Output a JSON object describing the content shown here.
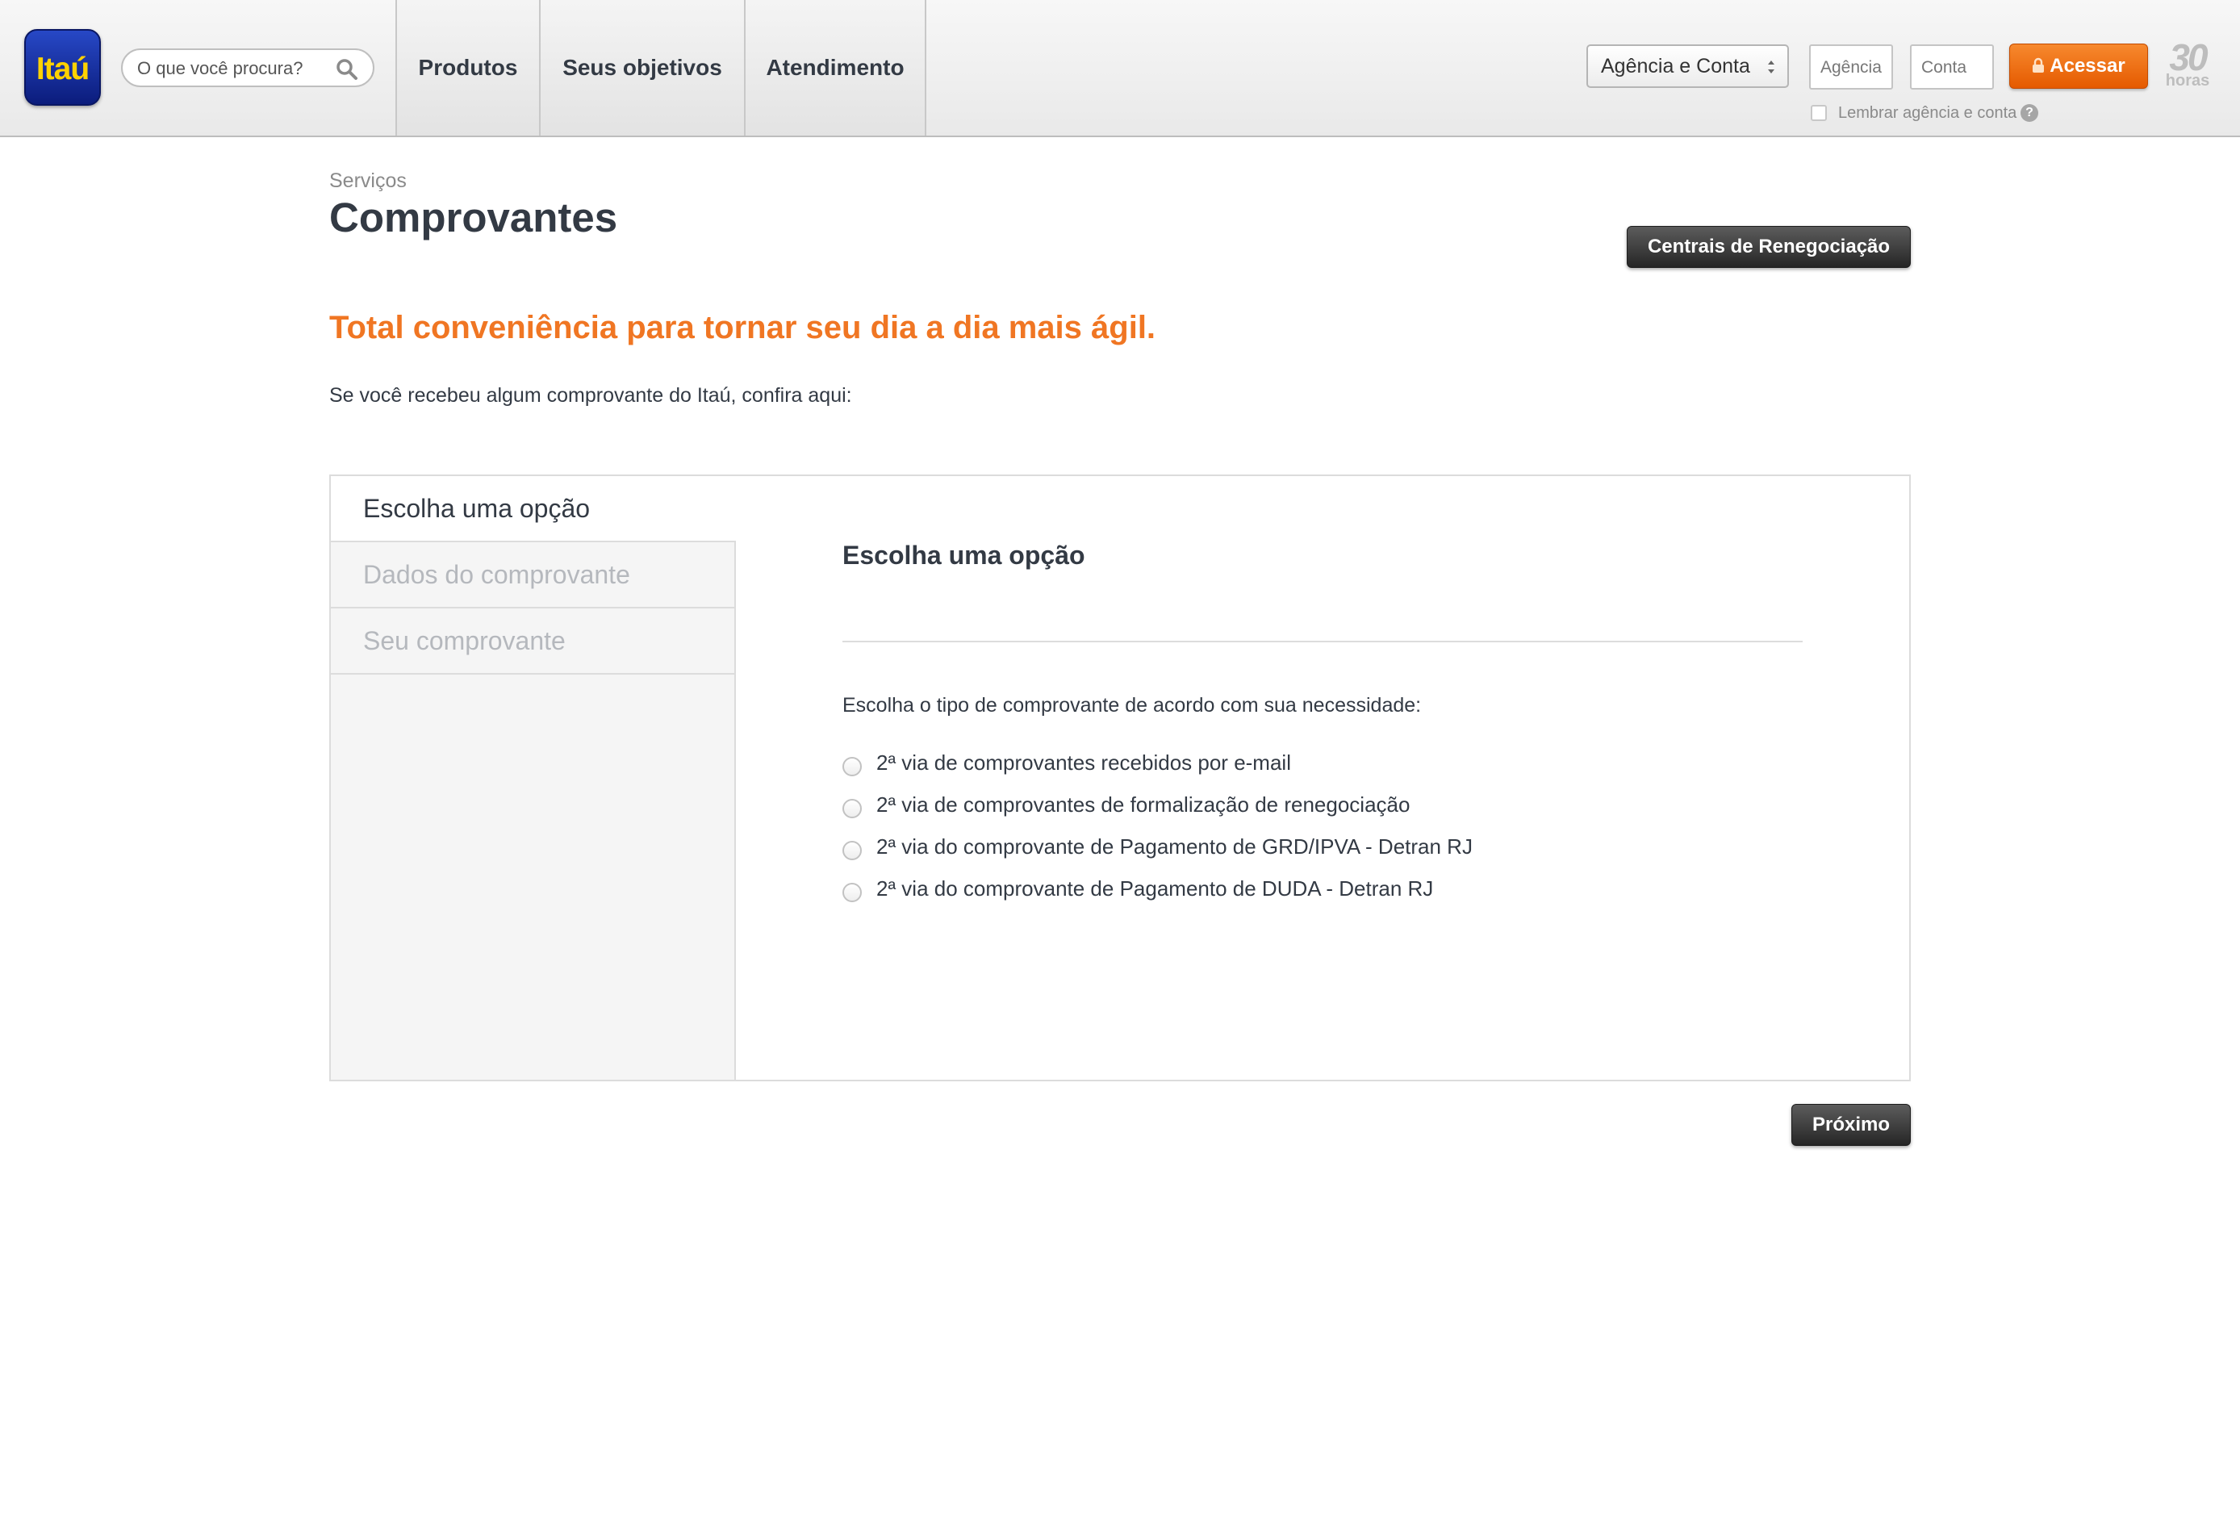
{
  "header": {
    "logo_text": "Itaú",
    "search": {
      "placeholder": "O que você procura?"
    },
    "nav": [
      "Produtos",
      "Seus objetivos",
      "Atendimento"
    ],
    "login": {
      "type_select": "Agência e Conta",
      "agencia_placeholder": "Agência",
      "conta_placeholder": "Conta",
      "acessar_label": "Acessar",
      "remember_label": "Lembrar agência e conta",
      "help_glyph": "?"
    },
    "badge_30": {
      "number": "30",
      "text": "horas"
    }
  },
  "page": {
    "breadcrumb": "Serviços",
    "title": "Comprovantes",
    "renegociacao_button": "Centrais de Renegociação",
    "headline": "Total conveniência para tornar seu dia a dia mais ágil.",
    "intro": "Se você recebeu algum comprovante do Itaú, confira aqui:"
  },
  "wizard": {
    "steps": [
      "Escolha uma opção",
      "Dados do comprovante",
      "Seu comprovante"
    ],
    "active_step": 0,
    "content_title": "Escolha uma opção",
    "question": "Escolha o tipo de comprovante de acordo com sua necessidade:",
    "options": [
      "2ª via de comprovantes recebidos por e-mail",
      "2ª via de comprovantes de formalização de renegociação",
      "2ª via do comprovante de Pagamento de GRD/IPVA - Detran RJ",
      "2ª via do comprovante de Pagamento de DUDA - Detran RJ"
    ],
    "next_button": "Próximo"
  },
  "colors": {
    "brand_blue": "#1e3fb8",
    "brand_yellow": "#ffd200",
    "accent_orange": "#f07623",
    "button_dark": "#333333",
    "text_dark": "#333a44"
  },
  "icons": {
    "search": "search-icon",
    "select_arrows": "chevron-updown-icon",
    "lock": "lock-icon",
    "help": "help-icon"
  }
}
